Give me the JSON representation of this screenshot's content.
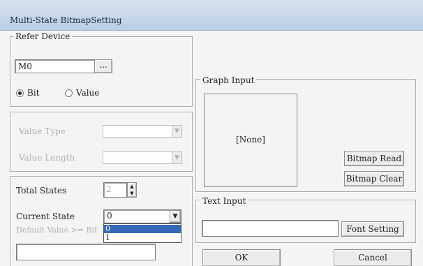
{
  "window": {
    "title": "Multi-State BitmapSetting"
  },
  "refer_device": {
    "legend": "Refer Device",
    "device_value": "M0",
    "browse_label": "...",
    "radio_bit_label": "Bit",
    "radio_value_label": "Value",
    "selected": "Bit"
  },
  "value_group": {
    "value_type_label": "Value Type",
    "value_length_label": "Value Length"
  },
  "states": {
    "total_states_label": "Total States",
    "total_states_value": "2",
    "current_state_label": "Current State",
    "current_state_value": "0",
    "current_state_options": [
      "0",
      "1"
    ],
    "default_value_label": "Default Value >= Bit"
  },
  "graph_input": {
    "legend": "Graph Input",
    "preview_text": "[None]",
    "bitmap_read_label": "Bitmap Read",
    "bitmap_clear_label": "Bitmap Clear"
  },
  "text_input": {
    "legend": "Text Input",
    "font_setting_label": "Font Setting"
  },
  "footer": {
    "ok_label": "OK",
    "cancel_label": "Cancel"
  }
}
